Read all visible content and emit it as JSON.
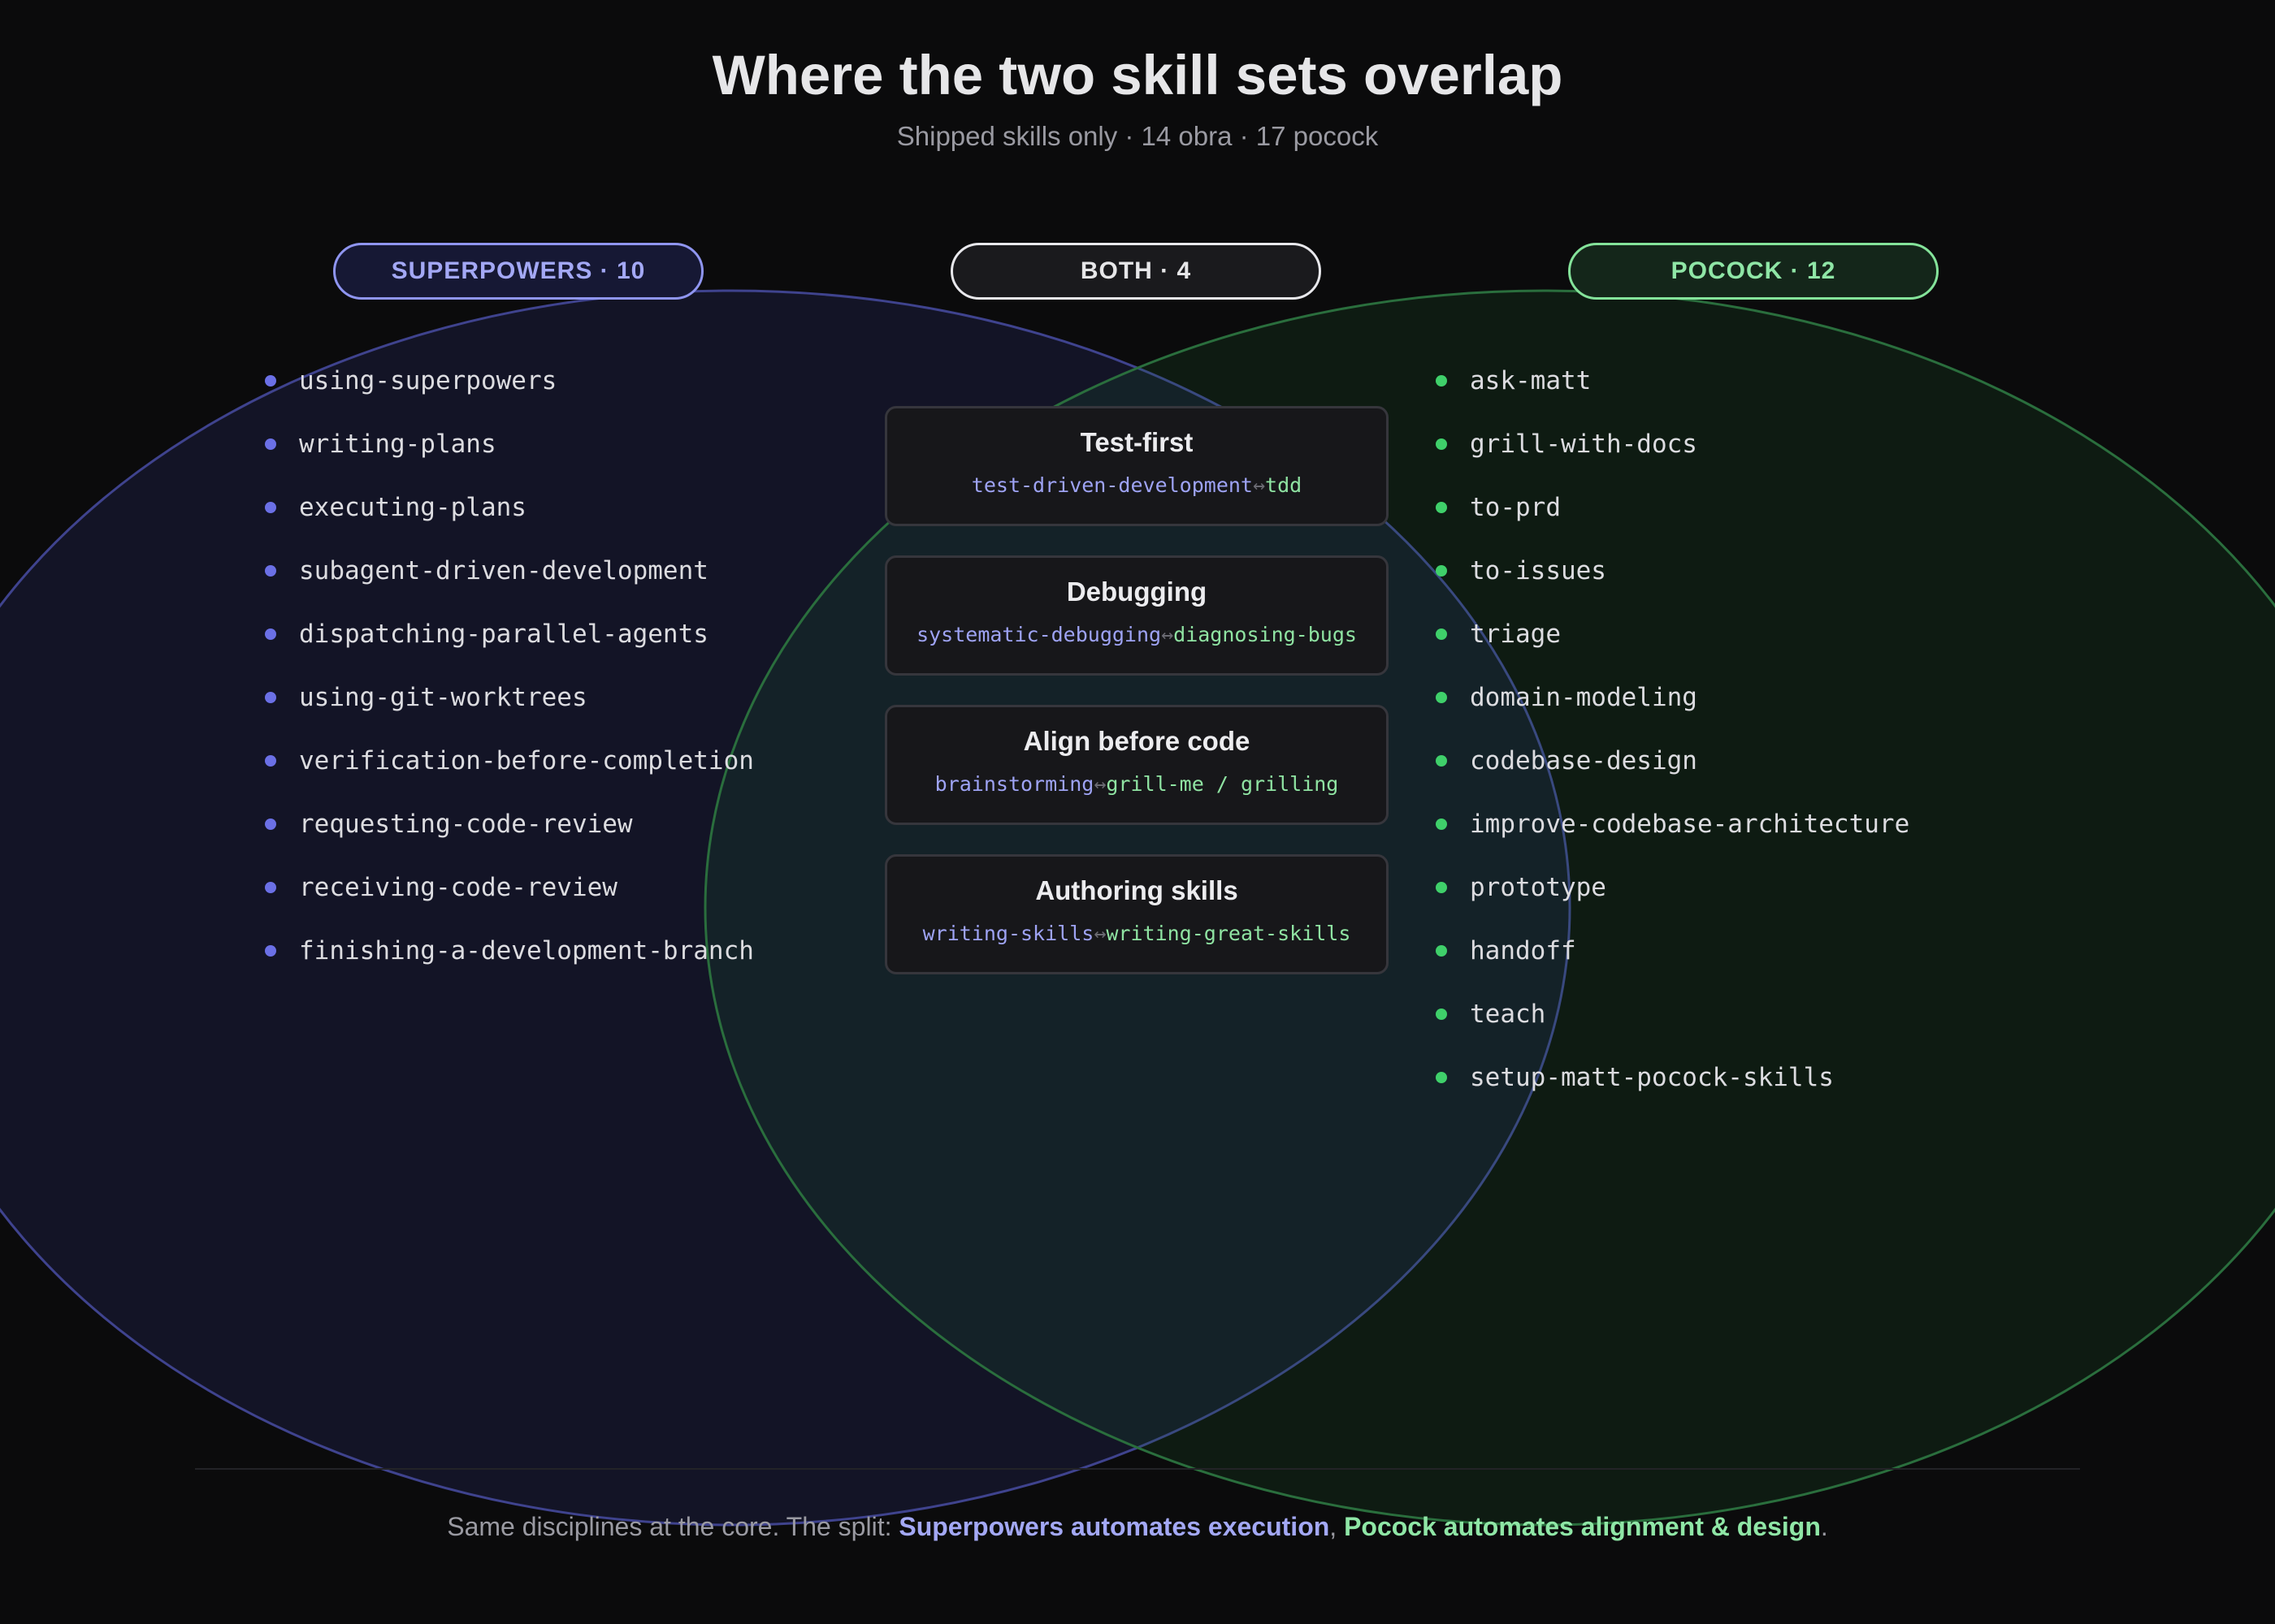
{
  "title": "Where the two skill sets overlap",
  "subtitle": "Shipped skills only · 14 obra · 17 pocock",
  "colors": {
    "background": "#0b0b0c",
    "superpowers_accent": "#8f95f0",
    "pocock_accent": "#84e39a",
    "both_accent": "#e8e8ec",
    "superpowers_bullet": "#6b70e6",
    "pocock_bullet": "#3fd06a"
  },
  "groups": {
    "superpowers": {
      "label": "SUPERPOWERS · 10",
      "skills": [
        "using-superpowers",
        "writing-plans",
        "executing-plans",
        "subagent-driven-development",
        "dispatching-parallel-agents",
        "using-git-worktrees",
        "verification-before-completion",
        "requesting-code-review",
        "receiving-code-review",
        "finishing-a-development-branch"
      ]
    },
    "both": {
      "label": "BOTH · 4",
      "pairs": [
        {
          "title": "Test-first",
          "left": "test-driven-development",
          "arrow": "↔",
          "right": "tdd"
        },
        {
          "title": "Debugging",
          "left": "systematic-debugging",
          "arrow": "↔",
          "right": "diagnosing-bugs"
        },
        {
          "title": "Align before code",
          "left": "brainstorming",
          "arrow": "↔",
          "right": "grill-me / grilling"
        },
        {
          "title": "Authoring skills",
          "left": "writing-skills",
          "arrow": "↔",
          "right": "writing-great-skills"
        }
      ]
    },
    "pocock": {
      "label": "POCOCK · 12",
      "skills": [
        "ask-matt",
        "grill-with-docs",
        "to-prd",
        "to-issues",
        "triage",
        "domain-modeling",
        "codebase-design",
        "improve-codebase-architecture",
        "prototype",
        "handoff",
        "teach",
        "setup-matt-pocock-skills"
      ]
    }
  },
  "footer": {
    "prefix": "Same disciplines at the core. The split: ",
    "superpowers_text": "Superpowers automates execution",
    "separator": ", ",
    "pocock_text": "Pocock automates alignment & design",
    "suffix": "."
  }
}
